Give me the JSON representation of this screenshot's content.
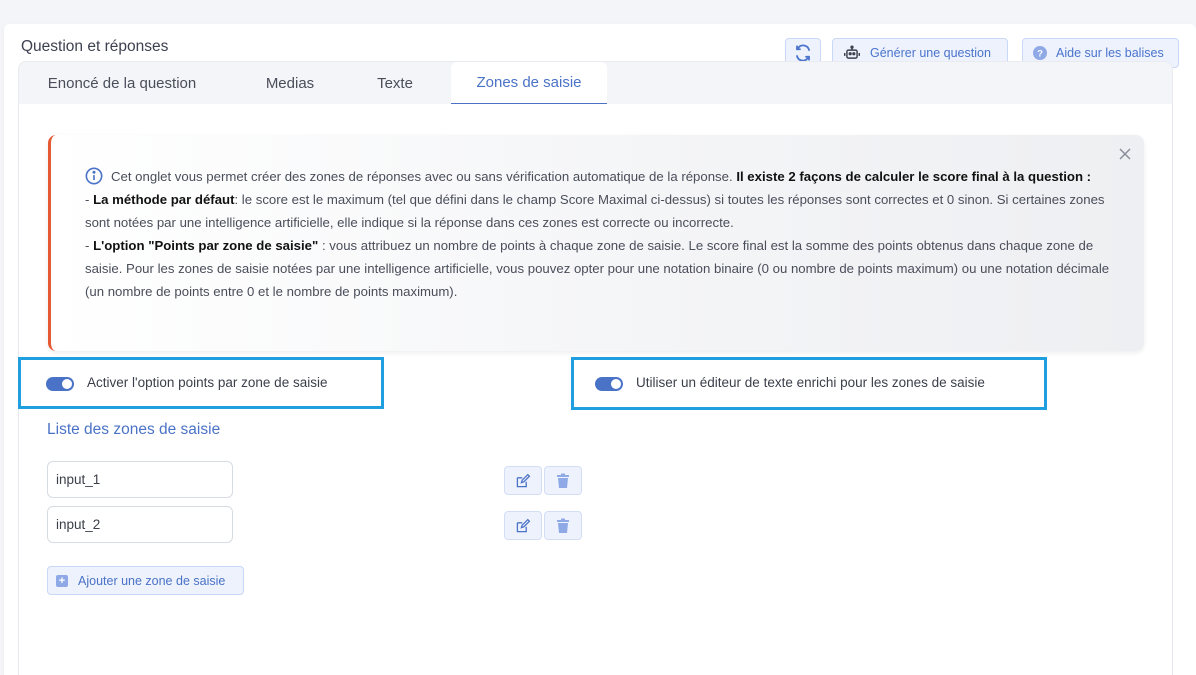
{
  "header": {
    "title": "Question et réponses",
    "generate_label": "Générer une question",
    "help_label": "Aide sur les balises"
  },
  "tabs": [
    {
      "label": "Enoncé de la question",
      "active": false
    },
    {
      "label": "Medias",
      "active": false
    },
    {
      "label": "Texte",
      "active": false
    },
    {
      "label": "Zones de saisie",
      "active": true
    }
  ],
  "alert": {
    "intro": "Cet onglet vous permet créer des zones de réponses avec ou sans vérification automatique de la réponse. ",
    "intro_bold": "Il existe 2 façons de calculer le score final à la question :",
    "m1_prefix": "- ",
    "m1_bold": "La méthode par défaut",
    "m1_text": ": le score est le maximum (tel que défini dans le champ Score Maximal ci-dessus) si toutes les réponses sont correctes et 0 sinon. Si certaines zones sont notées par une intelligence artificielle, elle indique si la réponse dans ces zones est correcte ou incorrecte.",
    "m2_prefix": "- ",
    "m2_bold": "L'option \"Points par zone de saisie\"",
    "m2_text": " : vous attribuez un nombre de points à chaque zone de saisie. Le score final est la somme des points obtenus dans chaque zone de saisie. Pour les zones de saisie notées par une intelligence artificielle, vous pouvez opter pour une notation binaire (0 ou nombre de points maximum) ou une notation décimale (un nombre de points entre 0 et le nombre de points maximum)."
  },
  "options": {
    "points_per_zone_label": "Activer l'option points par zone de saisie",
    "points_per_zone_enabled": true,
    "rich_editor_label": "Utiliser un éditeur de texte enrichi pour les zones de saisie",
    "rich_editor_enabled": true
  },
  "zones": {
    "title": "Liste des zones de saisie",
    "items": [
      {
        "value": "input_1"
      },
      {
        "value": "input_2"
      }
    ],
    "add_label": "Ajouter une zone de saisie"
  },
  "colors": {
    "accent": "#4a72c6",
    "alert_border": "#e65a33",
    "highlight": "#1f9fe0"
  }
}
